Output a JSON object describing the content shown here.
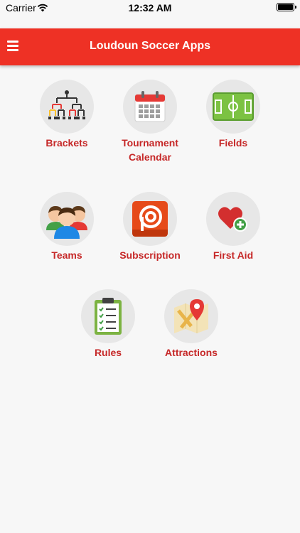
{
  "status_bar": {
    "carrier": "Carrier",
    "time": "12:32 AM"
  },
  "header": {
    "title": "Loudoun Soccer Apps",
    "menu_icon": "hamburger-menu-icon"
  },
  "colors": {
    "brand": "#ee3125",
    "label": "#c62828",
    "circle": "#e7e7e7"
  },
  "tiles": [
    {
      "label": "Brackets",
      "icon": "brackets-icon"
    },
    {
      "label": "Tournament\nCalendar",
      "icon": "calendar-icon"
    },
    {
      "label": "Fields",
      "icon": "soccer-field-icon"
    },
    {
      "label": "Teams",
      "icon": "teams-icon"
    },
    {
      "label": "Subscription",
      "icon": "subscription-icon"
    },
    {
      "label": "First Aid",
      "icon": "first-aid-icon"
    },
    {
      "label": "Rules",
      "icon": "rules-clipboard-icon"
    },
    {
      "label": "Attractions",
      "icon": "map-pin-icon"
    }
  ]
}
